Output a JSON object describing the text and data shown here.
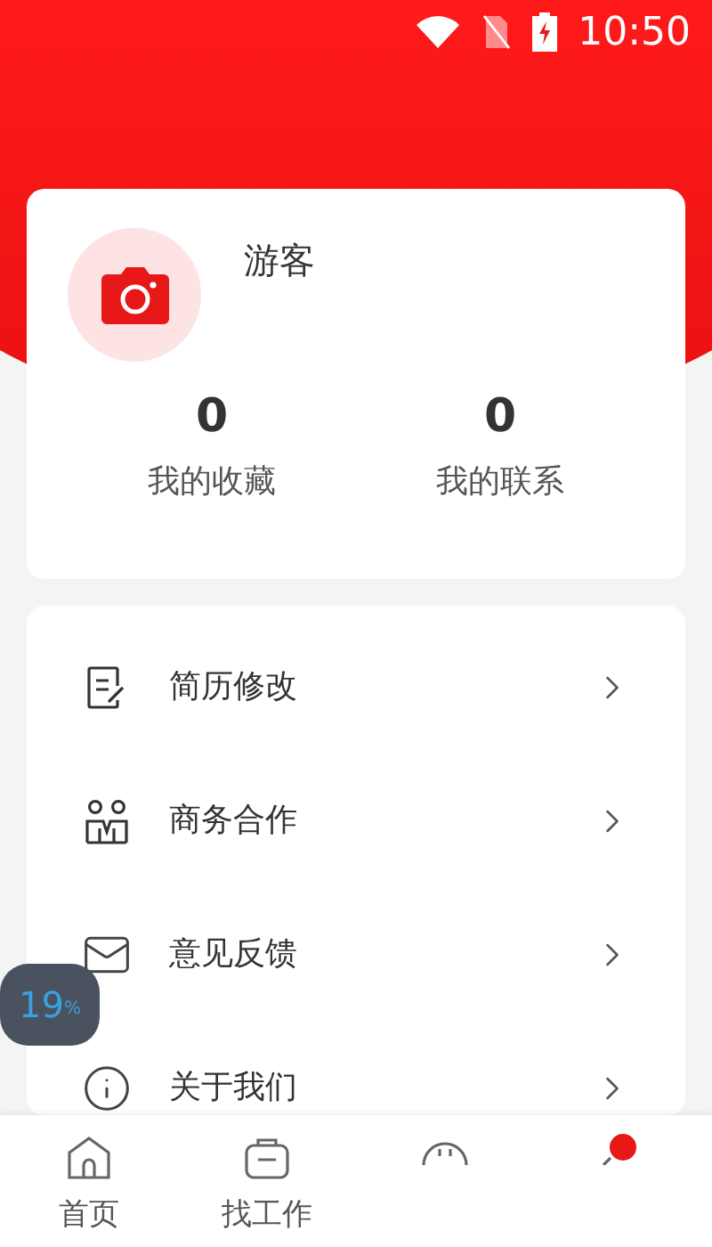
{
  "status_bar": {
    "time": "10:50"
  },
  "profile": {
    "name": "游客",
    "stats": [
      {
        "value": "0",
        "label": "我的收藏"
      },
      {
        "value": "0",
        "label": "我的联系"
      }
    ]
  },
  "menu": [
    {
      "kind": "resume",
      "label": "简历修改"
    },
    {
      "kind": "business",
      "label": "商务合作"
    },
    {
      "kind": "feedback",
      "label": "意见反馈"
    },
    {
      "kind": "about",
      "label": "关于我们"
    }
  ],
  "floating_badge": {
    "value": "19",
    "unit": "%"
  },
  "bottom_nav": [
    {
      "kind": "home",
      "label": "首页",
      "selected": false
    },
    {
      "kind": "jobs",
      "label": "找工作",
      "selected": false
    },
    {
      "kind": "messages",
      "selected": false
    },
    {
      "kind": "me",
      "selected": true
    }
  ]
}
